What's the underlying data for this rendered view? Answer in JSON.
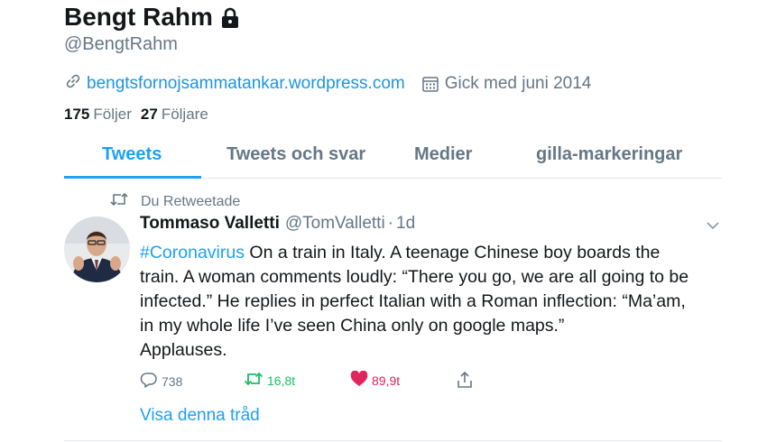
{
  "profile": {
    "name": "Bengt Rahm",
    "handle": "@BengtRahm",
    "website": "bengtsfornojsammatankar.wordpress.com",
    "joined": "Gick med juni 2014",
    "following_count": "175",
    "following_label": "Följer",
    "followers_count": "27",
    "followers_label": "Följare"
  },
  "tabs": [
    {
      "label": "Tweets",
      "active": true
    },
    {
      "label": "Tweets och svar",
      "active": false
    },
    {
      "label": "Medier",
      "active": false
    },
    {
      "label": "gilla-markeringar",
      "active": false
    }
  ],
  "tweet": {
    "retweet_notice": "Du Retweetade",
    "author_name": "Tommaso Valletti",
    "author_handle": "@TomValletti",
    "separator": "·",
    "time": "1d",
    "hashtag": "#Coronavirus",
    "lines": [
      " On a train in Italy. A teenage Chinese boy boards the",
      "train. A woman comments loudly: “There you go, we are all going to be",
      "infected.” He replies in perfect Italian with a Roman inflection: “Ma’am,",
      "in my whole life I’ve seen China only on google maps.”",
      "Applauses."
    ],
    "replies": "738",
    "retweets": "16,8t",
    "likes": "89,9t",
    "show_thread": "Visa denna tråd"
  },
  "colors": {
    "accent": "#1da1f2",
    "muted": "#657786",
    "retweet_green": "#17bf63",
    "like_red": "#e0245e"
  },
  "icons": [
    "lock-icon",
    "link-icon",
    "calendar-icon",
    "retweet-icon",
    "chevron-down-icon",
    "reply-icon",
    "heart-icon",
    "share-icon"
  ]
}
